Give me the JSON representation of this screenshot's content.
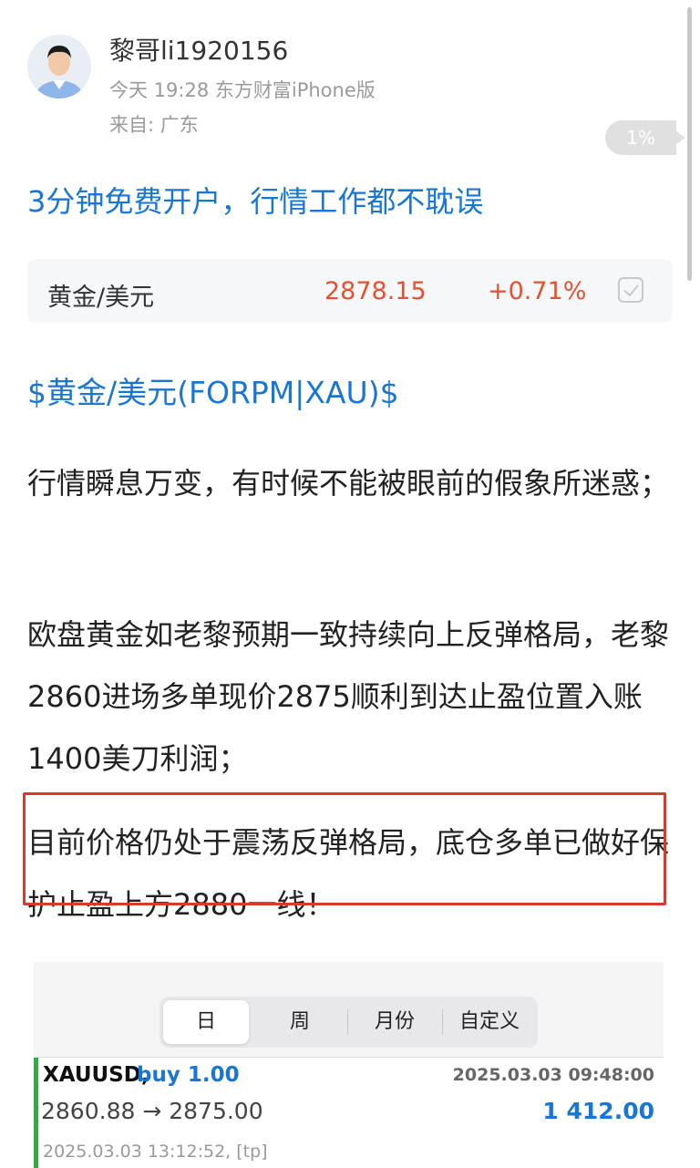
{
  "author": {
    "name": "黎哥li1920156",
    "post_meta": "今天 19:28 东方财富iPhone版",
    "location": "来自: 广东"
  },
  "reading_progress": "1%",
  "promo_link": "3分钟免费开户，行情工作都不耽误",
  "quote": {
    "name": "黄金/美元",
    "price": "2878.15",
    "change": "+0.71%"
  },
  "stock_tag": "$黄金/美元(FORPM|XAU)$",
  "paragraphs": {
    "p1": "行情瞬息万变，有时候不能被眼前的假象所迷惑；",
    "p2": "欧盘黄金如老黎预期一致持续向上反弹格局，老黎2860进场多单现价2875顺利到达止盈位置入账1400美刀利润；",
    "p3": "目前价格仍处于震荡反弹格局，底仓多单已做好保护止盈上方2880一线！"
  },
  "trade_panel": {
    "tabs": [
      "日",
      "周",
      "月份",
      "自定义"
    ],
    "active_tab": "日",
    "trade": {
      "symbol": "XAUUSD,",
      "direction": "buy 1.00",
      "open_time": "2025.03.03 09:48:00",
      "prices": "2860.88 → 2875.00",
      "profit": "1 412.00",
      "close_info": "2025.03.03 13:12:52, [tp]"
    }
  },
  "colors": {
    "link_blue": "#1976d2",
    "price_red": "#e5502e",
    "highlight_red": "#d83a2c",
    "trade_green": "#2eae3c"
  },
  "icons": [
    "avatar",
    "checkbox-icon"
  ]
}
